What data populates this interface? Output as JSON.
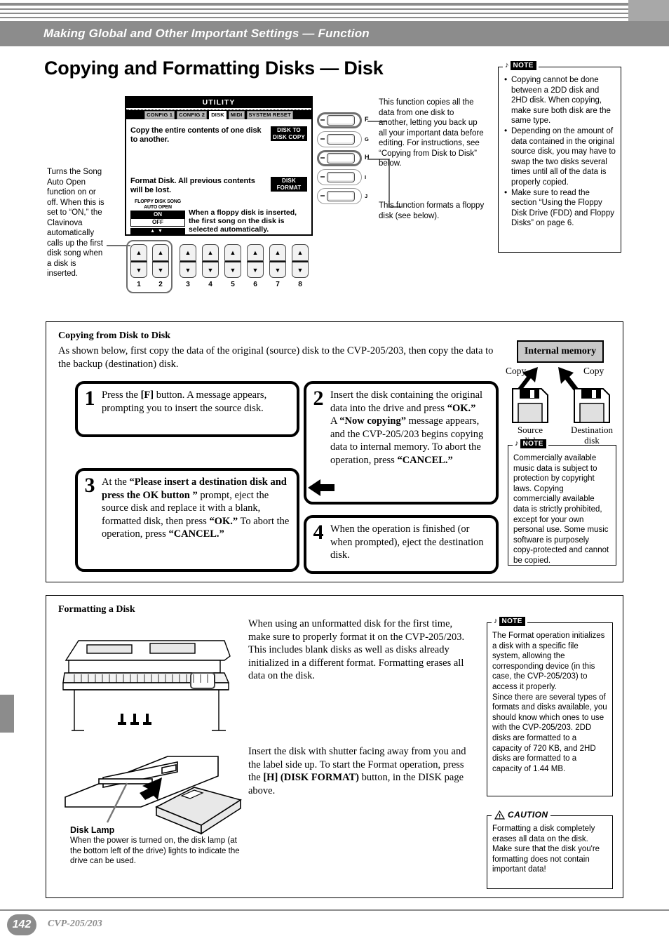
{
  "header": {
    "title": "Making Global and Other Important Settings — Function"
  },
  "page_title": "Copying and Formatting Disks — Disk",
  "lcd": {
    "title": "UTILITY",
    "tabs": [
      {
        "label": "CONFIG 1",
        "active": false
      },
      {
        "label": "CONFIG 2",
        "active": false
      },
      {
        "label": "DISK",
        "active": true
      },
      {
        "label": "MIDI",
        "active": false
      },
      {
        "label": "SYSTEM RESET",
        "active": false
      }
    ],
    "rows": [
      {
        "text": "Copy the entire contents of one disk to another.",
        "button": "DISK TO DISK COPY"
      },
      {
        "text": "Format Disk. All previous contents will be lost.",
        "button": "DISK FORMAT"
      }
    ],
    "auto_open": {
      "caption": "FLOPPY DISK SONG AUTO OPEN",
      "on": "ON",
      "off": "OFF",
      "arrows": "▲▼"
    },
    "auto_open_note": "When a floppy disk is inserted, the first song on the disk is selected automatically."
  },
  "panel_buttons": {
    "letters": [
      "F",
      "G",
      "H",
      "I",
      "J"
    ],
    "highlighted": [
      "F",
      "H"
    ],
    "numbers": [
      "1",
      "2",
      "3",
      "4",
      "5",
      "6",
      "7",
      "8"
    ],
    "grouped_numbers": [
      "1",
      "2"
    ],
    "arrow_up": "▲",
    "arrow_down": "▼"
  },
  "callouts": {
    "left": "Turns the Song Auto Open function on or off. When this is set to “ON,” the Clavinova automatically calls up the first disk song when a disk is inserted.",
    "right_top": "This function copies all the data from one disk to another, letting you back up all your important data before editing. For instructions, see “Copying from Disk to Disk” below.",
    "right_bottom": "This function formats a floppy disk (see below)."
  },
  "note_top": {
    "label": "NOTE",
    "music_icon": "♪",
    "items": [
      "Copying cannot be done between a 2DD disk and 2HD disk. When copying, make sure both disk are the same type.",
      "Depending on the amount of data contained in the original source disk, you may have to swap the two disks several times until all of the data is properly copied.",
      "Make sure to read the section “Using the Floppy Disk Drive (FDD) and Floppy Disks” on page 6."
    ]
  },
  "copy_section": {
    "heading": "Copying from Disk to Disk",
    "intro": "As shown below, first copy the data of the original (source) disk to the CVP-205/203, then copy the data to the backup (destination) disk.",
    "steps": [
      {
        "number": "1",
        "parts": [
          {
            "text": "Press the ",
            "bold": false
          },
          {
            "text": "[F]",
            "bold": true
          },
          {
            "text": " button. A message appears, prompting you to insert the source disk.",
            "bold": false
          }
        ]
      },
      {
        "number": "2",
        "parts": [
          {
            "text": "Insert the disk containing the original data into the drive and press ",
            "bold": false
          },
          {
            "text": "“OK.”",
            "bold": true
          },
          {
            "text": "\nA ",
            "bold": false
          },
          {
            "text": "“Now copying”",
            "bold": true
          },
          {
            "text": " message appears, and the CVP-205/203 begins copying data to internal memory. To abort the operation, press ",
            "bold": false
          },
          {
            "text": "“CANCEL.”",
            "bold": true
          }
        ]
      },
      {
        "number": "3",
        "parts": [
          {
            "text": "At the ",
            "bold": false
          },
          {
            "text": "“Please insert a destination disk and press the OK button ”",
            "bold": true
          },
          {
            "text": " prompt, eject the source disk and replace it with a blank, formatted disk, then press ",
            "bold": false
          },
          {
            "text": "“OK.”",
            "bold": true
          },
          {
            "text": " To abort the operation, press ",
            "bold": false
          },
          {
            "text": "“CANCEL.”",
            "bold": true
          }
        ]
      },
      {
        "number": "4",
        "parts": [
          {
            "text": "When the operation is finished (or when prompted), eject the destination disk.",
            "bold": false
          }
        ]
      }
    ],
    "diagram": {
      "internal_memory": "Internal memory",
      "copy_left": "Copy",
      "copy_right": "Copy",
      "source_label": "Source\ndisk",
      "destination_label": "Destination\ndisk"
    },
    "note_copyright": {
      "label": "NOTE",
      "music_icon": "♪",
      "text": "Commercially available music data is subject to protection by copyright laws. Copying commercially available data is strictly prohibited, except for your own personal use. Some music software is purposely copy-protected and cannot be copied."
    }
  },
  "format_section": {
    "heading": "Formatting a Disk",
    "paragraph1": "When using an unformatted disk for the first time, make sure to properly format it on the CVP-205/203. This includes blank disks as well as disks already initialized in a different format. Formatting erases all data on the disk.",
    "paragraph2_parts": [
      {
        "text": "Insert the disk with shutter facing away from you and the label side up. To start the Format operation, press the ",
        "bold": false
      },
      {
        "text": "[H]",
        "bold": true
      },
      {
        "text": " ",
        "bold": false
      },
      {
        "text": "(DISK FORMAT)",
        "bold": true
      },
      {
        "text": " button, in the DISK page above.",
        "bold": false
      }
    ],
    "disk_lamp": {
      "title": "Disk Lamp",
      "text": "When the power is turned on, the disk lamp (at the bottom left of the drive) lights to indicate the drive can be used."
    },
    "note_format": {
      "label": "NOTE",
      "music_icon": "♪",
      "text": "The Format operation initializes a disk with a specific file system, allowing the corresponding device (in this case, the CVP-205/203) to access it properly.\nSince there are several types of formats and disks available, you should know which ones to use with the CVP-205/203. 2DD disks are formatted to a capacity of 720 KB, and 2HD disks are formatted to a capacity of 1.44 MB."
    },
    "caution": {
      "label": "CAUTION",
      "icon": "⚠",
      "text": "Formatting a disk completely erases all data on the disk. Make sure that the disk you're formatting does not contain important data!"
    }
  },
  "footer": {
    "page_number": "142",
    "model": "CVP-205/203"
  },
  "colors": {
    "band_gray": "#8c8c8c",
    "panel_gray": "#c8c8c8",
    "black": "#000000"
  }
}
